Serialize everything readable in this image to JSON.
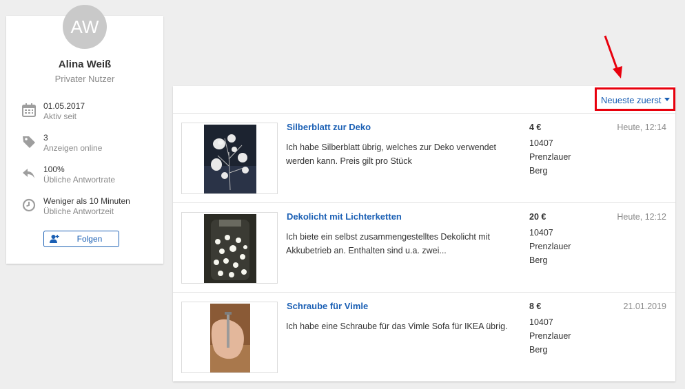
{
  "profile": {
    "avatar_initials": "AW",
    "name": "Alina Weiß",
    "role": "Privater Nutzer",
    "stats": [
      {
        "icon": "calendar-icon",
        "value": "01.05.2017",
        "label": "Aktiv seit"
      },
      {
        "icon": "tag-icon",
        "value": "3",
        "label": "Anzeigen online"
      },
      {
        "icon": "reply-icon",
        "value": "100%",
        "label": "Übliche Antwortrate"
      },
      {
        "icon": "clock-icon",
        "value": "Weniger als 10 Minuten",
        "label": "Übliche Antwortzeit"
      }
    ],
    "follow_label": "Folgen"
  },
  "sort": {
    "label": "Neueste zuerst",
    "highlight_color": "#e8000d"
  },
  "listings": [
    {
      "title": "Silberblatt zur Deko",
      "description": "Ich habe Silberblatt übrig, welches zur Deko verwendet werden kann. Preis gilt pro Stück",
      "price": "4 €",
      "location": "10407 Prenzlauer Berg",
      "date": "Heute, 12:14"
    },
    {
      "title": "Dekolicht mit Lichterketten",
      "description": "Ich biete ein selbst zusammengestelltes Dekolicht mit Akkubetrieb an. Enthalten sind u.a. zwei...",
      "price": "20 €",
      "location": "10407 Prenzlauer Berg",
      "date": "Heute, 12:12"
    },
    {
      "title": "Schraube für Vimle",
      "description": "Ich habe eine Schraube für das Vimle Sofa für IKEA übrig.",
      "price": "8 €",
      "location": "10407 Prenzlauer Berg",
      "date": "21.01.2019"
    }
  ],
  "colors": {
    "link": "#1a5fb4",
    "muted": "#8a8a8a",
    "annotation_arrow": "#e8000d"
  }
}
